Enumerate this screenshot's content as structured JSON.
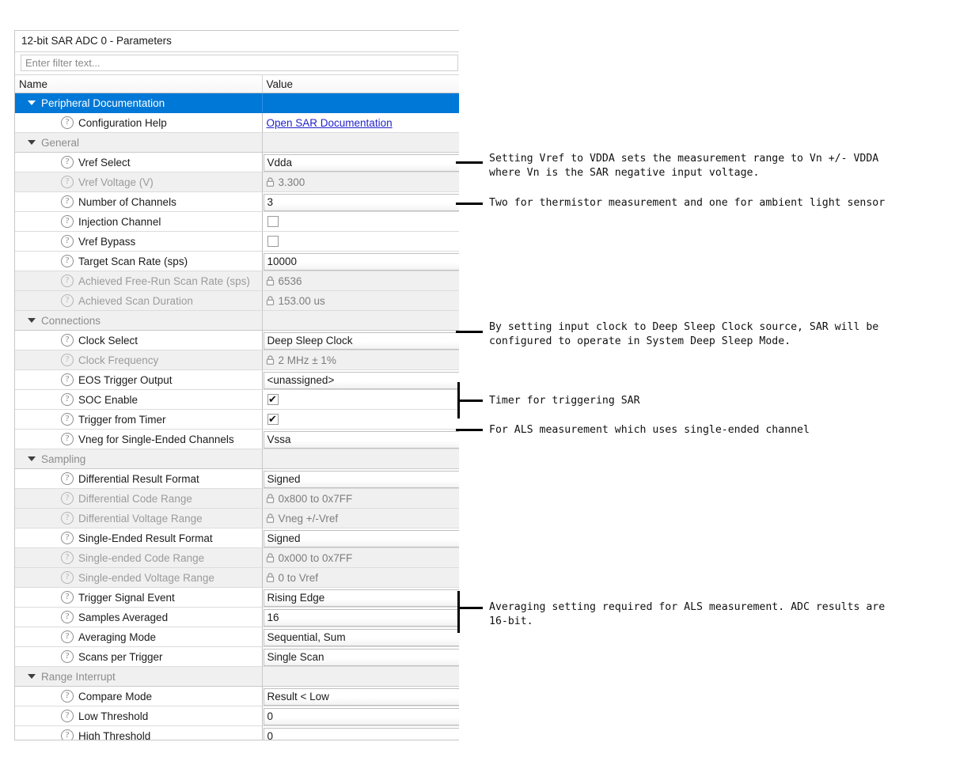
{
  "panel": {
    "title": "12-bit SAR ADC 0 - Parameters",
    "filter_placeholder": "Enter filter text...",
    "filter_value": "",
    "columns": {
      "name": "Name",
      "value": "Value"
    },
    "accent_color": "#0078d7",
    "link_color": "#2222cc"
  },
  "rows": [
    {
      "kind": "group",
      "name": "Peripheral Documentation",
      "value": "",
      "selected": true
    },
    {
      "kind": "param",
      "name": "Configuration Help",
      "value": "Open SAR Documentation",
      "value_type": "link"
    },
    {
      "kind": "group",
      "name": "General",
      "value": ""
    },
    {
      "kind": "param",
      "name": "Vref Select",
      "value": "Vdda",
      "value_type": "combo"
    },
    {
      "kind": "readonly",
      "name": "Vref Voltage (V)",
      "value": "3.300",
      "value_type": "locked"
    },
    {
      "kind": "param",
      "name": "Number of Channels",
      "value": "3",
      "value_type": "combo"
    },
    {
      "kind": "param",
      "name": "Injection Channel",
      "value": "",
      "value_type": "checkbox",
      "checked": false
    },
    {
      "kind": "param",
      "name": "Vref Bypass",
      "value": "",
      "value_type": "checkbox",
      "checked": false
    },
    {
      "kind": "param",
      "name": "Target Scan Rate (sps)",
      "value": "10000",
      "value_type": "text"
    },
    {
      "kind": "readonly",
      "name": "Achieved Free-Run Scan Rate (sps)",
      "value": "6536",
      "value_type": "locked"
    },
    {
      "kind": "readonly",
      "name": "Achieved Scan Duration",
      "value": "153.00 us",
      "value_type": "locked"
    },
    {
      "kind": "group",
      "name": "Connections",
      "value": ""
    },
    {
      "kind": "param",
      "name": "Clock Select",
      "value": "Deep Sleep Clock",
      "value_type": "combo"
    },
    {
      "kind": "readonly",
      "name": "Clock Frequency",
      "value": "2 MHz ± 1%",
      "value_type": "locked"
    },
    {
      "kind": "param",
      "name": "EOS Trigger Output",
      "value": "<unassigned>",
      "value_type": "combo"
    },
    {
      "kind": "param",
      "name": "SOC Enable",
      "value": "",
      "value_type": "checkbox",
      "checked": true
    },
    {
      "kind": "param",
      "name": "Trigger from Timer",
      "value": "",
      "value_type": "checkbox",
      "checked": true
    },
    {
      "kind": "param",
      "name": "Vneg for Single-Ended Channels",
      "value": "Vssa",
      "value_type": "combo"
    },
    {
      "kind": "group",
      "name": "Sampling",
      "value": ""
    },
    {
      "kind": "param",
      "name": "Differential Result Format",
      "value": "Signed",
      "value_type": "combo"
    },
    {
      "kind": "readonly",
      "name": "Differential Code Range",
      "value": "0x800 to 0x7FF",
      "value_type": "locked"
    },
    {
      "kind": "readonly",
      "name": "Differential Voltage Range",
      "value": "Vneg +/-Vref",
      "value_type": "locked"
    },
    {
      "kind": "param",
      "name": "Single-Ended Result Format",
      "value": "Signed",
      "value_type": "combo"
    },
    {
      "kind": "readonly",
      "name": "Single-ended Code Range",
      "value": "0x000 to 0x7FF",
      "value_type": "locked"
    },
    {
      "kind": "readonly",
      "name": "Single-ended Voltage Range",
      "value": "0 to Vref",
      "value_type": "locked"
    },
    {
      "kind": "param",
      "name": "Trigger Signal Event",
      "value": "Rising Edge",
      "value_type": "combo"
    },
    {
      "kind": "param",
      "name": "Samples Averaged",
      "value": "16",
      "value_type": "text"
    },
    {
      "kind": "param",
      "name": "Averaging Mode",
      "value": "Sequential, Sum",
      "value_type": "combo"
    },
    {
      "kind": "param",
      "name": "Scans per Trigger",
      "value": "Single Scan",
      "value_type": "combo"
    },
    {
      "kind": "group",
      "name": "Range Interrupt",
      "value": ""
    },
    {
      "kind": "param",
      "name": "Compare Mode",
      "value": "Result < Low",
      "value_type": "combo"
    },
    {
      "kind": "param",
      "name": "Low Threshold",
      "value": "0",
      "value_type": "text"
    },
    {
      "kind": "param",
      "name": "High Threshold",
      "value": "0",
      "value_type": "text"
    }
  ],
  "annotations": [
    {
      "id": "ann-vref-select",
      "text": "Setting Vref to VDDA sets the measurement range to Vn +/- VDDA\nwhere Vn is the SAR negative input voltage.",
      "target_row": "Vref Select"
    },
    {
      "id": "ann-number-of-channels",
      "text": "Two for thermistor measurement and one for ambient light sensor",
      "target_row": "Number of Channels"
    },
    {
      "id": "ann-clock-select",
      "text": "By setting input clock to Deep Sleep Clock source, SAR will be\nconfigured to operate in System Deep Sleep Mode.",
      "target_row": "Clock Select"
    },
    {
      "id": "ann-soc-trigger",
      "text": "Timer for triggering SAR",
      "target_row": "SOC Enable, Trigger from Timer"
    },
    {
      "id": "ann-vneg-single-ended",
      "text": "For ALS measurement which uses single-ended channel",
      "target_row": "Vneg for Single-Ended Channels"
    },
    {
      "id": "ann-samples-averaged",
      "text": "Averaging setting required for ALS measurement. ADC results are\n16-bit.",
      "target_row": "Samples Averaged"
    }
  ]
}
